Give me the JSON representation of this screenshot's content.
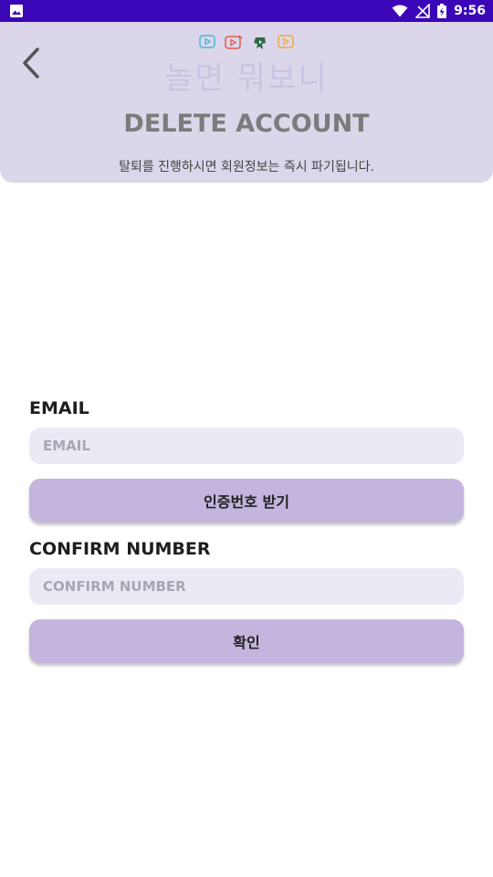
{
  "status_bar": {
    "time": "9:56",
    "icons": [
      "image-icon",
      "wifi-icon",
      "no-signal-icon",
      "battery-charging-icon"
    ]
  },
  "header": {
    "logo_text": "놀면 뭐보니",
    "logo_icons": [
      "play-icon-cyan",
      "play-icon-red",
      "play-icon-green",
      "play-icon-orange"
    ],
    "title": "DELETE ACCOUNT",
    "subtitle": "탈퇴를 진행하시면 회원정보는 즉시 파기됩니다."
  },
  "form": {
    "email_label": "EMAIL",
    "email_placeholder": "EMAIL",
    "email_value": "",
    "send_code_button": "인증번호 받기",
    "confirm_label": "CONFIRM NUMBER",
    "confirm_placeholder": "CONFIRM NUMBER",
    "confirm_value": "",
    "confirm_button": "확인"
  },
  "colors": {
    "status_bar": "#3b06b8",
    "header_bg": "#dcd6ea",
    "input_bg": "#ece9f5",
    "button_bg": "#c3b5dd"
  }
}
